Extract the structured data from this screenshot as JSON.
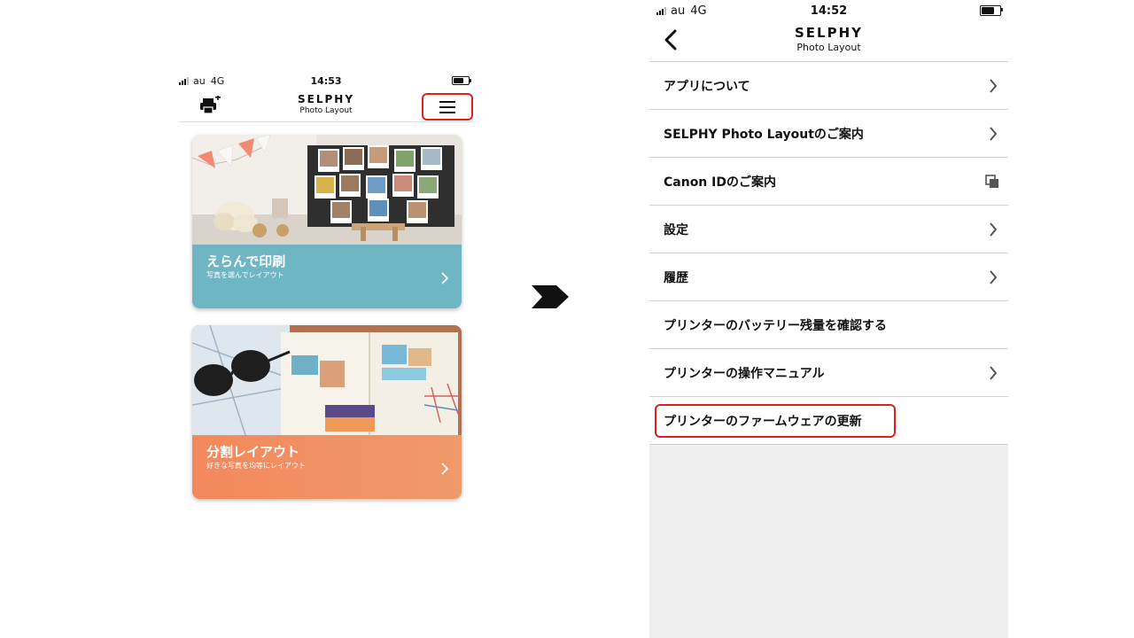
{
  "left_screen": {
    "status": {
      "carrier": "au",
      "network": "4G",
      "time": "14:53"
    },
    "header": {
      "logo_main": "SELPHY",
      "logo_sub": "Photo Layout"
    },
    "cards": [
      {
        "title": "えらんで印刷",
        "subtitle": "写真を選んでレイアウト"
      },
      {
        "title": "分割レイアウト",
        "subtitle": "好きな写真を均等にレイアウト"
      }
    ]
  },
  "right_screen": {
    "status": {
      "carrier": "au",
      "network": "4G",
      "time": "14:52"
    },
    "header": {
      "logo_main": "SELPHY",
      "logo_sub": "Photo Layout"
    },
    "menu_items": [
      {
        "label": "アプリについて",
        "icon": "chevron-right-icon"
      },
      {
        "label": "SELPHY Photo Layoutのご案内",
        "icon": "chevron-right-icon"
      },
      {
        "label": "Canon IDのご案内",
        "icon": "external-link-icon"
      },
      {
        "label": "設定",
        "icon": "chevron-right-icon"
      },
      {
        "label": "履歴",
        "icon": "chevron-right-icon"
      },
      {
        "label": "プリンターのバッテリー残量を確認する",
        "icon": ""
      },
      {
        "label": "プリンターの操作マニュアル",
        "icon": "chevron-right-icon"
      },
      {
        "label": "プリンターのファームウェアの更新",
        "icon": ""
      }
    ]
  },
  "colors": {
    "highlight": "#e01e1e",
    "card1_band": "#6fb6c5",
    "card2_band": "#f3885c",
    "menu_background": "#efefef"
  }
}
